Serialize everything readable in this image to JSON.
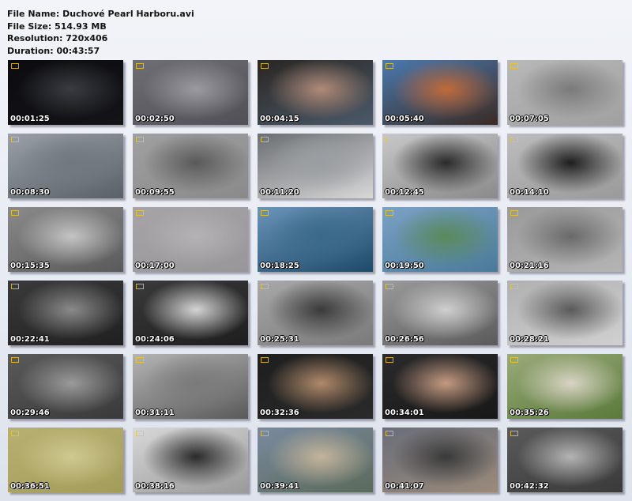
{
  "info": {
    "file_name": "File Name: Duchové Pearl Harboru.avi",
    "file_size": "File Size: 514.93 MB",
    "resolution": "Resolution: 720x406",
    "duration": "Duration: 00:43:57"
  },
  "thumbnails": [
    {
      "timestamp": "00:01:25",
      "colors": [
        "#0c0c10",
        "#3a3c42",
        "#141418"
      ]
    },
    {
      "timestamp": "00:02:50",
      "colors": [
        "#6e6e74",
        "#9a9aa0",
        "#505056"
      ]
    },
    {
      "timestamp": "00:04:15",
      "colors": [
        "#2a2622",
        "#b08a78",
        "#4a5a6a"
      ]
    },
    {
      "timestamp": "00:05:40",
      "colors": [
        "#4a7ab0",
        "#c06a3a",
        "#3a2a22"
      ]
    },
    {
      "timestamp": "00:07:05",
      "colors": [
        "#b8b8b8",
        "#7a7a7a",
        "#a0a0a0"
      ]
    },
    {
      "timestamp": "00:08:30",
      "colors": [
        "#9aa0a6",
        "#707880",
        "#5a6068"
      ]
    },
    {
      "timestamp": "00:09:55",
      "colors": [
        "#a0a0a0",
        "#5a5a5a",
        "#8a8a8a"
      ]
    },
    {
      "timestamp": "00:11:20",
      "colors": [
        "#6a6e72",
        "#9a9ea2",
        "#d8d8d8"
      ]
    },
    {
      "timestamp": "00:12:45",
      "colors": [
        "#c8c8c8",
        "#2a2a2a",
        "#8a8a8a"
      ]
    },
    {
      "timestamp": "00:14:10",
      "colors": [
        "#bcbcbc",
        "#1e1e1e",
        "#9a9a9a"
      ]
    },
    {
      "timestamp": "00:15:35",
      "colors": [
        "#8a8a8a",
        "#c4c4c4",
        "#5a5a5a"
      ]
    },
    {
      "timestamp": "00:17:00",
      "colors": [
        "#a6a4a6",
        "#b4b2b4",
        "#989698"
      ]
    },
    {
      "timestamp": "00:18:25",
      "colors": [
        "#6a94b8",
        "#3a6a8a",
        "#1e4a6a"
      ]
    },
    {
      "timestamp": "00:19:50",
      "colors": [
        "#7aa2c4",
        "#5a8a5a",
        "#4a7a9a"
      ]
    },
    {
      "timestamp": "00:21:16",
      "colors": [
        "#9a9a9a",
        "#6a6a6a",
        "#b4b4b4"
      ]
    },
    {
      "timestamp": "00:22:41",
      "colors": [
        "#3a3a3a",
        "#8a8a8a",
        "#202020"
      ]
    },
    {
      "timestamp": "00:24:06",
      "colors": [
        "#3a3a3a",
        "#d4d4d4",
        "#1e1e1e"
      ]
    },
    {
      "timestamp": "00:25:31",
      "colors": [
        "#a8a8a8",
        "#3a3a3a",
        "#7a7a7a"
      ]
    },
    {
      "timestamp": "00:26:56",
      "colors": [
        "#9a9a9a",
        "#cfcfcf",
        "#5a5a5a"
      ]
    },
    {
      "timestamp": "00:28:21",
      "colors": [
        "#b0b0b0",
        "#5a5a5a",
        "#d0d0d0"
      ]
    },
    {
      "timestamp": "00:29:46",
      "colors": [
        "#5a5a5a",
        "#9a9a9a",
        "#3a3a3a"
      ]
    },
    {
      "timestamp": "00:31:11",
      "colors": [
        "#b4b4b4",
        "#7a7a7a",
        "#5a5a5a"
      ]
    },
    {
      "timestamp": "00:32:36",
      "colors": [
        "#1e1e1e",
        "#b08a6a",
        "#2a2a2a"
      ]
    },
    {
      "timestamp": "00:34:01",
      "colors": [
        "#2a2a2a",
        "#c49a82",
        "#181818"
      ]
    },
    {
      "timestamp": "00:35:26",
      "colors": [
        "#9aaa7a",
        "#d8d4c4",
        "#5a7a3a"
      ]
    },
    {
      "timestamp": "00:36:51",
      "colors": [
        "#b8b070",
        "#cfc890",
        "#a49c5a"
      ]
    },
    {
      "timestamp": "00:38:16",
      "colors": [
        "#d8d8d8",
        "#2a2a2a",
        "#9a9a9a"
      ]
    },
    {
      "timestamp": "00:39:41",
      "colors": [
        "#7a8aa0",
        "#c4b49a",
        "#5a6a5a"
      ]
    },
    {
      "timestamp": "00:41:07",
      "colors": [
        "#6a6e7a",
        "#3a3a3a",
        "#9a8a7a"
      ]
    },
    {
      "timestamp": "00:42:32",
      "colors": [
        "#5a5a5a",
        "#b4b4b4",
        "#3a3a3a"
      ]
    }
  ]
}
